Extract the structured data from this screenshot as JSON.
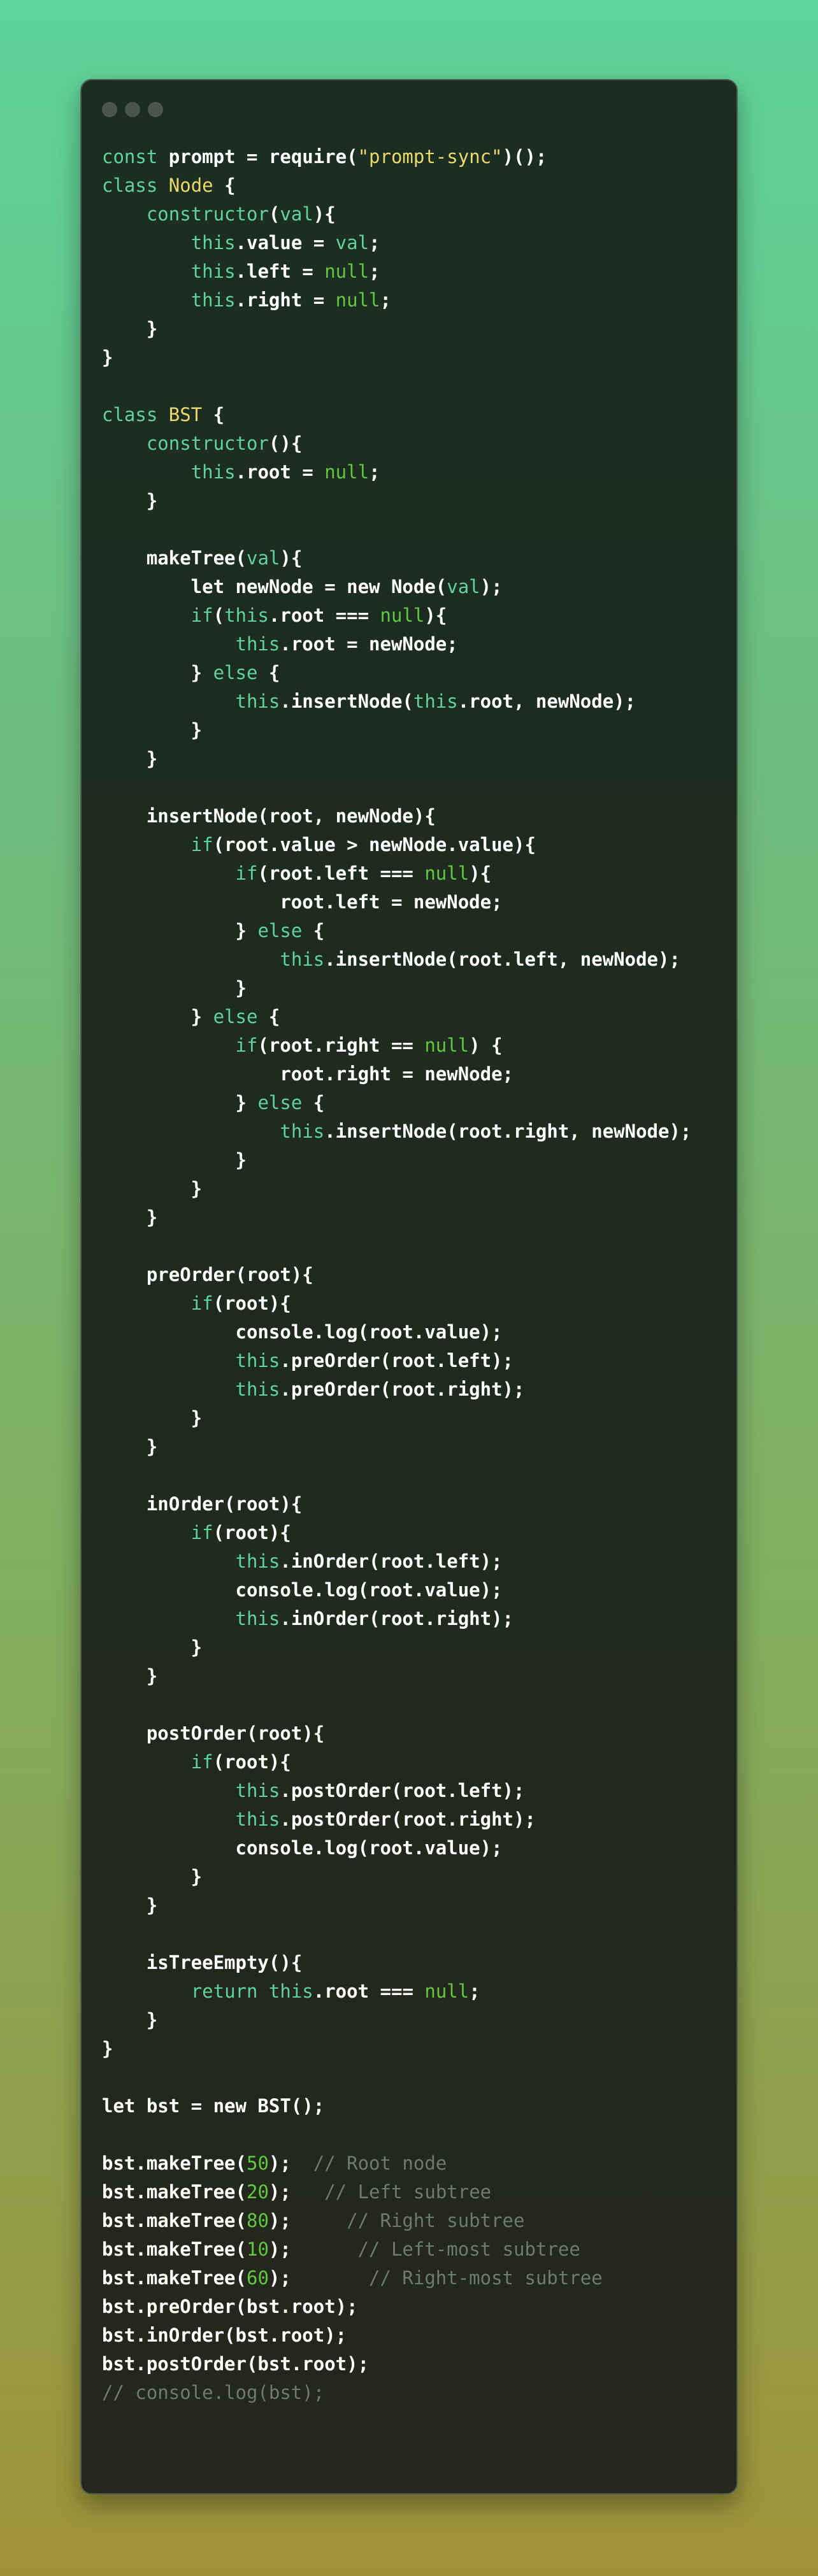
{
  "window": {
    "controls": [
      "close",
      "minimize",
      "maximize"
    ],
    "colors": {
      "background": "#1e2b1e",
      "text": "#f1f4ef",
      "keyword": "#5fd39b",
      "string": "#ead96b",
      "number": "#62c641",
      "comment": "#6b7b6f"
    }
  },
  "code": {
    "lines": [
      [
        [
          "kw",
          "const"
        ],
        [
          "tt",
          " prompt = require("
        ],
        [
          "str",
          "\"prompt-sync\""
        ],
        [
          "tt",
          ")();"
        ]
      ],
      [
        [
          "kw",
          "class"
        ],
        [
          "tt",
          " "
        ],
        [
          "ty",
          "Node"
        ],
        [
          "tt",
          " {"
        ]
      ],
      [
        [
          "tt",
          "    "
        ],
        [
          "kw",
          "constructor"
        ],
        [
          "tt",
          "("
        ],
        [
          "pm",
          "val"
        ],
        [
          "tt",
          "){"
        ]
      ],
      [
        [
          "tt",
          "        "
        ],
        [
          "kw",
          "this"
        ],
        [
          "tt",
          ".value = "
        ],
        [
          "pm",
          "val"
        ],
        [
          "tt",
          ";"
        ]
      ],
      [
        [
          "tt",
          "        "
        ],
        [
          "kw",
          "this"
        ],
        [
          "tt",
          ".left = "
        ],
        [
          "nu",
          "null"
        ],
        [
          "tt",
          ";"
        ]
      ],
      [
        [
          "tt",
          "        "
        ],
        [
          "kw",
          "this"
        ],
        [
          "tt",
          ".right = "
        ],
        [
          "nu",
          "null"
        ],
        [
          "tt",
          ";"
        ]
      ],
      [
        [
          "tt",
          "    }"
        ]
      ],
      [
        [
          "tt",
          "}"
        ]
      ],
      [],
      [
        [
          "kw",
          "class"
        ],
        [
          "tt",
          " "
        ],
        [
          "ty",
          "BST"
        ],
        [
          "tt",
          " {"
        ]
      ],
      [
        [
          "tt",
          "    "
        ],
        [
          "kw",
          "constructor"
        ],
        [
          "tt",
          "(){"
        ]
      ],
      [
        [
          "tt",
          "        "
        ],
        [
          "kw",
          "this"
        ],
        [
          "tt",
          ".root = "
        ],
        [
          "nu",
          "null"
        ],
        [
          "tt",
          ";"
        ]
      ],
      [
        [
          "tt",
          "    }"
        ]
      ],
      [],
      [
        [
          "tt",
          "    makeTree("
        ],
        [
          "pm",
          "val"
        ],
        [
          "tt",
          "){"
        ]
      ],
      [
        [
          "tt",
          "        let newNode = new Node("
        ],
        [
          "pm",
          "val"
        ],
        [
          "tt",
          ");"
        ]
      ],
      [
        [
          "tt",
          "        "
        ],
        [
          "kw",
          "if"
        ],
        [
          "tt",
          "("
        ],
        [
          "kw",
          "this"
        ],
        [
          "tt",
          ".root === "
        ],
        [
          "nu",
          "null"
        ],
        [
          "tt",
          "){"
        ]
      ],
      [
        [
          "tt",
          "            "
        ],
        [
          "kw",
          "this"
        ],
        [
          "tt",
          ".root = newNode;"
        ]
      ],
      [
        [
          "tt",
          "        } "
        ],
        [
          "kw",
          "else"
        ],
        [
          "tt",
          " {"
        ]
      ],
      [
        [
          "tt",
          "            "
        ],
        [
          "kw",
          "this"
        ],
        [
          "tt",
          ".insertNode("
        ],
        [
          "kw",
          "this"
        ],
        [
          "tt",
          ".root, newNode);"
        ]
      ],
      [
        [
          "tt",
          "        }"
        ]
      ],
      [
        [
          "tt",
          "    }"
        ]
      ],
      [],
      [
        [
          "tt",
          "    insertNode(root, newNode){"
        ]
      ],
      [
        [
          "tt",
          "        "
        ],
        [
          "kw",
          "if"
        ],
        [
          "tt",
          "(root.value > newNode.value){"
        ]
      ],
      [
        [
          "tt",
          "            "
        ],
        [
          "kw",
          "if"
        ],
        [
          "tt",
          "(root.left === "
        ],
        [
          "nu",
          "null"
        ],
        [
          "tt",
          "){"
        ]
      ],
      [
        [
          "tt",
          "                root.left = newNode;"
        ]
      ],
      [
        [
          "tt",
          "            } "
        ],
        [
          "kw",
          "else"
        ],
        [
          "tt",
          " {"
        ]
      ],
      [
        [
          "tt",
          "                "
        ],
        [
          "kw",
          "this"
        ],
        [
          "tt",
          ".insertNode(root.left, newNode);"
        ]
      ],
      [
        [
          "tt",
          "            }"
        ]
      ],
      [
        [
          "tt",
          "        } "
        ],
        [
          "kw",
          "else"
        ],
        [
          "tt",
          " {"
        ]
      ],
      [
        [
          "tt",
          "            "
        ],
        [
          "kw",
          "if"
        ],
        [
          "tt",
          "(root.right == "
        ],
        [
          "nu",
          "null"
        ],
        [
          "tt",
          ") {"
        ]
      ],
      [
        [
          "tt",
          "                root.right = newNode;"
        ]
      ],
      [
        [
          "tt",
          "            } "
        ],
        [
          "kw",
          "else"
        ],
        [
          "tt",
          " {"
        ]
      ],
      [
        [
          "tt",
          "                "
        ],
        [
          "kw",
          "this"
        ],
        [
          "tt",
          ".insertNode(root.right, newNode);"
        ]
      ],
      [
        [
          "tt",
          "            }"
        ]
      ],
      [
        [
          "tt",
          "        }"
        ]
      ],
      [
        [
          "tt",
          "    }"
        ]
      ],
      [],
      [
        [
          "tt",
          "    preOrder(root){"
        ]
      ],
      [
        [
          "tt",
          "        "
        ],
        [
          "kw",
          "if"
        ],
        [
          "tt",
          "(root){"
        ]
      ],
      [
        [
          "tt",
          "            console.log(root.value);"
        ]
      ],
      [
        [
          "tt",
          "            "
        ],
        [
          "kw",
          "this"
        ],
        [
          "tt",
          ".preOrder(root.left);"
        ]
      ],
      [
        [
          "tt",
          "            "
        ],
        [
          "kw",
          "this"
        ],
        [
          "tt",
          ".preOrder(root.right);"
        ]
      ],
      [
        [
          "tt",
          "        }"
        ]
      ],
      [
        [
          "tt",
          "    }"
        ]
      ],
      [],
      [
        [
          "tt",
          "    inOrder(root){"
        ]
      ],
      [
        [
          "tt",
          "        "
        ],
        [
          "kw",
          "if"
        ],
        [
          "tt",
          "(root){"
        ]
      ],
      [
        [
          "tt",
          "            "
        ],
        [
          "kw",
          "this"
        ],
        [
          "tt",
          ".inOrder(root.left);"
        ]
      ],
      [
        [
          "tt",
          "            console.log(root.value);"
        ]
      ],
      [
        [
          "tt",
          "            "
        ],
        [
          "kw",
          "this"
        ],
        [
          "tt",
          ".inOrder(root.right);"
        ]
      ],
      [
        [
          "tt",
          "        }"
        ]
      ],
      [
        [
          "tt",
          "    }"
        ]
      ],
      [],
      [
        [
          "tt",
          "    postOrder(root){"
        ]
      ],
      [
        [
          "tt",
          "        "
        ],
        [
          "kw",
          "if"
        ],
        [
          "tt",
          "(root){"
        ]
      ],
      [
        [
          "tt",
          "            "
        ],
        [
          "kw",
          "this"
        ],
        [
          "tt",
          ".postOrder(root.left);"
        ]
      ],
      [
        [
          "tt",
          "            "
        ],
        [
          "kw",
          "this"
        ],
        [
          "tt",
          ".postOrder(root.right);"
        ]
      ],
      [
        [
          "tt",
          "            console.log(root.value);"
        ]
      ],
      [
        [
          "tt",
          "        }"
        ]
      ],
      [
        [
          "tt",
          "    }"
        ]
      ],
      [],
      [
        [
          "tt",
          "    isTreeEmpty(){"
        ]
      ],
      [
        [
          "tt",
          "        "
        ],
        [
          "kw",
          "return"
        ],
        [
          "tt",
          " "
        ],
        [
          "kw",
          "this"
        ],
        [
          "tt",
          ".root === "
        ],
        [
          "nu",
          "null"
        ],
        [
          "tt",
          ";"
        ]
      ],
      [
        [
          "tt",
          "    }"
        ]
      ],
      [
        [
          "tt",
          "}"
        ]
      ],
      [],
      [
        [
          "tt",
          "let bst = new BST();"
        ]
      ],
      [],
      [
        [
          "tt",
          "bst.makeTree("
        ],
        [
          "nu",
          "50"
        ],
        [
          "tt",
          ");  "
        ],
        [
          "cm",
          "// Root node"
        ]
      ],
      [
        [
          "tt",
          "bst.makeTree("
        ],
        [
          "nu",
          "20"
        ],
        [
          "tt",
          ");   "
        ],
        [
          "cm",
          "// Left subtree"
        ]
      ],
      [
        [
          "tt",
          "bst.makeTree("
        ],
        [
          "nu",
          "80"
        ],
        [
          "tt",
          ");     "
        ],
        [
          "cm",
          "// Right subtree"
        ]
      ],
      [
        [
          "tt",
          "bst.makeTree("
        ],
        [
          "nu",
          "10"
        ],
        [
          "tt",
          ");      "
        ],
        [
          "cm",
          "// Left-most subtree"
        ]
      ],
      [
        [
          "tt",
          "bst.makeTree("
        ],
        [
          "nu",
          "60"
        ],
        [
          "tt",
          ");       "
        ],
        [
          "cm",
          "// Right-most subtree"
        ]
      ],
      [
        [
          "tt",
          "bst.preOrder(bst.root);"
        ]
      ],
      [
        [
          "tt",
          "bst.inOrder(bst.root);"
        ]
      ],
      [
        [
          "tt",
          "bst.postOrder(bst.root);"
        ]
      ],
      [
        [
          "cm",
          "// console.log(bst);"
        ]
      ]
    ]
  }
}
